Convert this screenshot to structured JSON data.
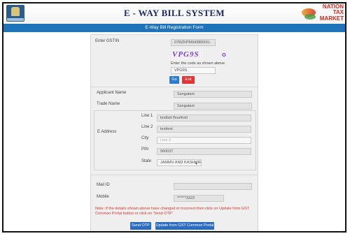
{
  "header": {
    "title": "E - WAY BILL SYSTEM",
    "brand_line1": "NATION",
    "brand_line2": "TAX",
    "brand_line3": "MARKET"
  },
  "subbar": {
    "title": "E-Way Bill Registration Form"
  },
  "form": {
    "gstin": {
      "label": "Enter GSTIN",
      "value": "07BZKPM9438M1KL"
    },
    "captcha": {
      "text": "VPG9S",
      "hint": "Enter the code as shown above",
      "value": "VPG9S"
    },
    "buttons": {
      "go": "Go",
      "exit": "Exit"
    },
    "applicant": {
      "label": "Applicant Name",
      "value": "Sangatani"
    },
    "trade": {
      "label": "Trade Name",
      "value": "Sangatani"
    },
    "address": {
      "label": "E Address",
      "line1": {
        "label": "Line 1",
        "value": "testbot flourfesti"
      },
      "line2": {
        "label": "Line 2",
        "value": "testtest"
      },
      "city": {
        "label": "City",
        "placeholder": "Line 3"
      },
      "pin": {
        "label": "PIN",
        "value": "560037"
      },
      "state": {
        "label": "State",
        "value": "JAMMU AND KASHMIR"
      }
    },
    "mail": {
      "label": "Mail ID",
      "value": ""
    },
    "mobile": {
      "label": "Mobile",
      "value": "******3323"
    },
    "note": "Note: If the details shown above have changed or incorrect then click on Update from GST Common Portal button or click on 'Send OTP'",
    "send_otp": "Send OTP",
    "update": "Update from GST Common Portal"
  }
}
